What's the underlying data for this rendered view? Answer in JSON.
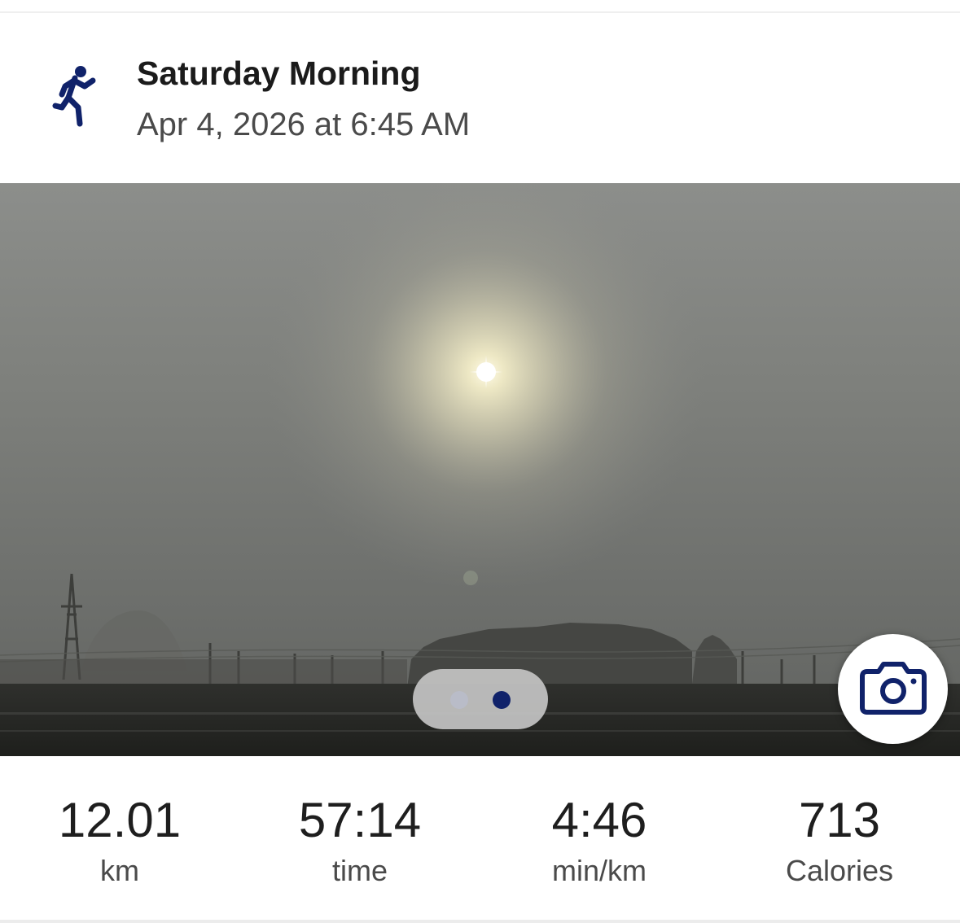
{
  "activity": {
    "type_icon": "running-figure-icon",
    "title": "Saturday Morning",
    "datetime": "Apr 4, 2026 at 6:45 AM"
  },
  "media": {
    "photo_subject": "foggy sunrise over fields",
    "page_count": 2,
    "current_page": 2,
    "camera_icon": "camera-icon"
  },
  "stats": [
    {
      "value": "12.01",
      "label": "km"
    },
    {
      "value": "57:14",
      "label": "time"
    },
    {
      "value": "4:46",
      "label": "min/km"
    },
    {
      "value": "713",
      "label": "Calories"
    }
  ],
  "colors": {
    "accent": "#10226a",
    "text_primary": "#1b1b1b",
    "text_secondary": "#4a4a4a"
  }
}
